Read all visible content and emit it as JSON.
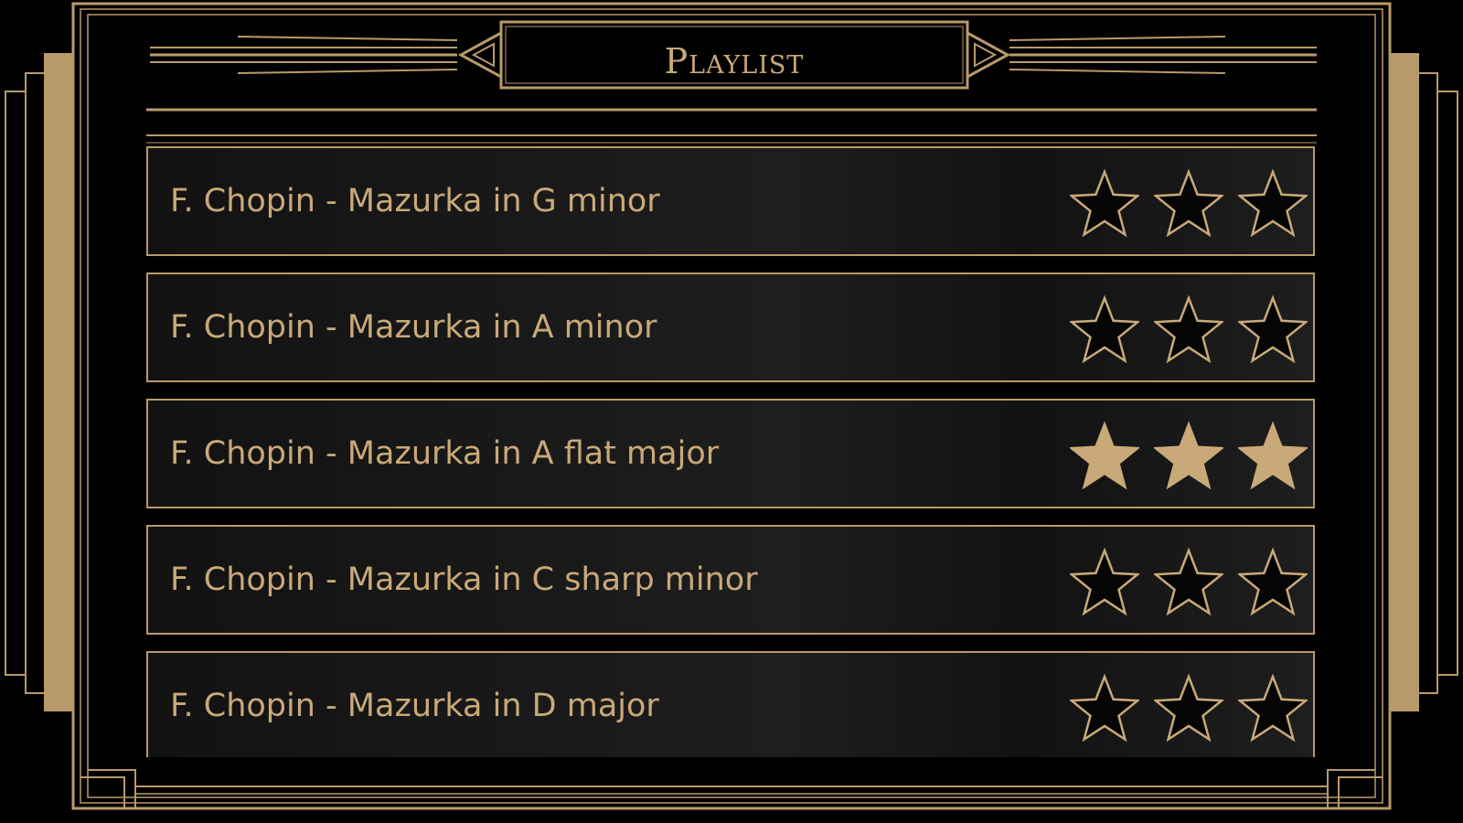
{
  "header": {
    "title": "Playlist"
  },
  "colors": {
    "gold": "#c9a978",
    "frame": "#b89a6a",
    "background": "#000000",
    "row_background": "#161616"
  },
  "playlist": [
    {
      "title": "F. Chopin - Mazurka in G minor",
      "rating": 0,
      "max_rating": 3
    },
    {
      "title": "F. Chopin - Mazurka in A minor",
      "rating": 0,
      "max_rating": 3
    },
    {
      "title": "F. Chopin - Mazurka in A flat major",
      "rating": 3,
      "max_rating": 3
    },
    {
      "title": "F. Chopin - Mazurka in C sharp minor",
      "rating": 0,
      "max_rating": 3
    },
    {
      "title": "F. Chopin - Mazurka in D major",
      "rating": 0,
      "max_rating": 3
    }
  ],
  "icons": {
    "star_filled": "star-filled-icon",
    "star_empty": "star-outline-icon"
  }
}
